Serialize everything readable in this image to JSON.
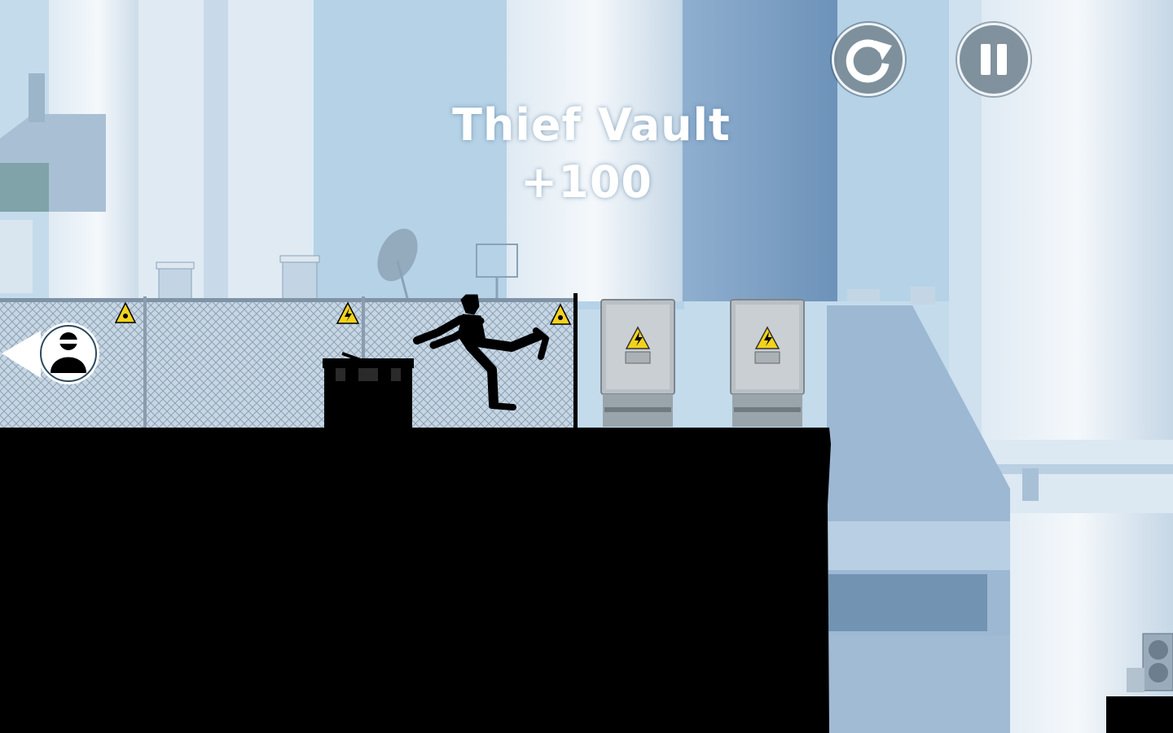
{
  "hud": {
    "restart_icon": "restart-icon",
    "pause_icon": "pause-icon"
  },
  "trick": {
    "name": "Thief Vault",
    "points": "+100"
  },
  "chaser": {
    "icon": "hunter-head-icon",
    "direction": "left"
  },
  "colors": {
    "sky": "#c9dcec",
    "silhouette": "#000000",
    "hud_button": "#788a96",
    "hud_border": "#eef3f7",
    "hazard_yellow": "#f3d21c"
  }
}
